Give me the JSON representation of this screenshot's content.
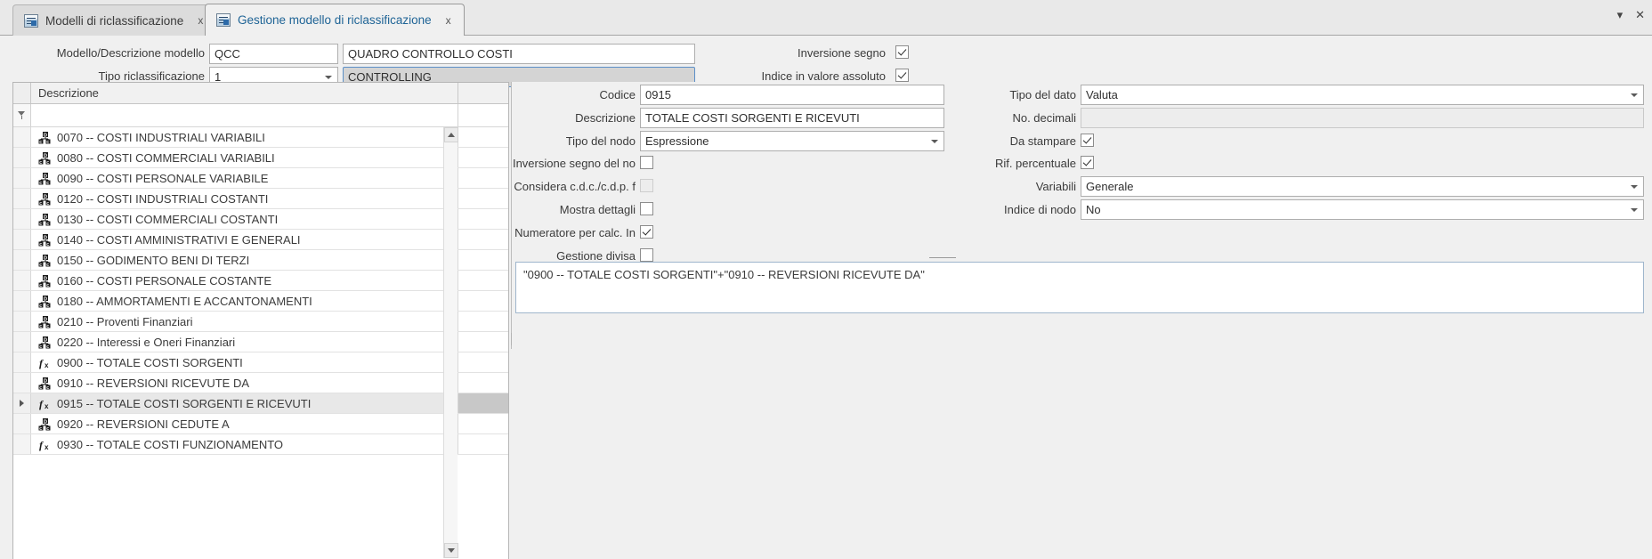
{
  "window": {
    "minimize_label": "▾",
    "close_label": "✕"
  },
  "tabs": [
    {
      "label": "Modelli di riclassificazione",
      "close": "x",
      "icon": "grid-report-icon",
      "active": false
    },
    {
      "label": "Gestione modello di riclassificazione",
      "close": "x",
      "icon": "grid-report-icon",
      "active": true
    }
  ],
  "header_form": {
    "modello_label": "Modello/Descrizione modello",
    "modello_code": "QCC",
    "modello_desc": "QUADRO CONTROLLO COSTI",
    "tipo_label": "Tipo riclassificazione",
    "tipo_value": "1",
    "tipo_desc": "CONTROLLING",
    "inversione_segno_label": "Inversione segno",
    "inversione_segno_checked": true,
    "indice_assoluto_label": "Indice in valore assoluto",
    "indice_assoluto_checked": true
  },
  "grid": {
    "columns": [
      "Descrizione"
    ],
    "rows": [
      {
        "icon": "cdc-node-icon",
        "text": "0070 -- COSTI INDUSTRIALI VARIABILI",
        "selected": false
      },
      {
        "icon": "cdc-node-icon",
        "text": "0080 -- COSTI COMMERCIALI VARIABILI",
        "selected": false
      },
      {
        "icon": "cdc-node-icon",
        "text": "0090 -- COSTI PERSONALE VARIABILE",
        "selected": false
      },
      {
        "icon": "cdc-node-icon",
        "text": "0120 -- COSTI INDUSTRIALI COSTANTI",
        "selected": false
      },
      {
        "icon": "cdc-node-icon",
        "text": "0130 -- COSTI COMMERCIALI COSTANTI",
        "selected": false
      },
      {
        "icon": "cdc-node-icon",
        "text": "0140 -- COSTI AMMINISTRATIVI E GENERALI",
        "selected": false
      },
      {
        "icon": "cdc-node-icon",
        "text": "0150 -- GODIMENTO BENI DI TERZI",
        "selected": false
      },
      {
        "icon": "cdc-node-icon",
        "text": "0160 -- COSTI PERSONALE COSTANTE",
        "selected": false
      },
      {
        "icon": "cdc-node-icon",
        "text": "0180 -- AMMORTAMENTI E ACCANTONAMENTI",
        "selected": false
      },
      {
        "icon": "cdc-node-icon",
        "text": "0210 -- Proventi Finanziari",
        "selected": false
      },
      {
        "icon": "cdc-node-icon",
        "text": "0220 -- Interessi e Oneri Finanziari",
        "selected": false
      },
      {
        "icon": "formula-icon",
        "text": "0900 -- TOTALE COSTI SORGENTI",
        "selected": false
      },
      {
        "icon": "cdc-node-icon",
        "text": "0910 -- REVERSIONI RICEVUTE DA",
        "selected": false
      },
      {
        "icon": "formula-icon",
        "text": "0915 -- TOTALE COSTI SORGENTI E RICEVUTI",
        "selected": true
      },
      {
        "icon": "cdc-node-icon",
        "text": "0920 -- REVERSIONI CEDUTE A",
        "selected": false
      },
      {
        "icon": "formula-icon",
        "text": "0930 -- TOTALE COSTI FUNZIONAMENTO",
        "selected": false
      }
    ]
  },
  "detail": {
    "codice_label": "Codice",
    "codice_value": "0915",
    "descrizione_label": "Descrizione",
    "descrizione_value": "TOTALE COSTI SORGENTI E RICEVUTI",
    "tipo_nodo_label": "Tipo del nodo",
    "tipo_nodo_value": "Espressione",
    "inversione_nodo_label": "Inversione segno del no",
    "inversione_nodo_checked": false,
    "considera_label": "Considera c.d.c./c.d.p. f",
    "considera_checked": false,
    "considera_disabled": true,
    "mostra_dettagli_label": "Mostra dettagli",
    "mostra_dettagli_checked": false,
    "numeratore_label": "Numeratore per calc. In",
    "numeratore_checked": true,
    "gestione_divisa_label": "Gestione divisa",
    "gestione_divisa_checked": false,
    "tipo_dato_label": "Tipo del dato",
    "tipo_dato_value": "Valuta",
    "no_decimali_label": "No. decimali",
    "no_decimali_value": "",
    "da_stampare_label": "Da stampare",
    "da_stampare_checked": true,
    "rif_percentuale_label": "Rif. percentuale",
    "rif_percentuale_checked": true,
    "variabili_label": "Variabili",
    "variabili_value": "Generale",
    "indice_nodo_label": "Indice di nodo",
    "indice_nodo_value": "No",
    "expression": "\"0900 -- TOTALE COSTI SORGENTI\"+\"0910 -- REVERSIONI RICEVUTE DA\""
  },
  "colors": {
    "accent": "#1f6496",
    "window_bg": "#f0f0f0",
    "selected_row": "#e8e8e8",
    "readonly_field": "#d4d4d4"
  }
}
